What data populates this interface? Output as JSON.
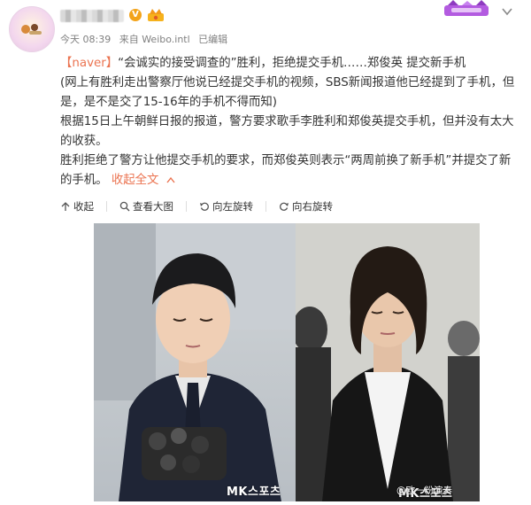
{
  "post": {
    "meta": {
      "time": "今天 08:39",
      "source": "来自 Weibo.intl",
      "edited": "已编辑"
    },
    "content": {
      "line1_tag": "【naver】",
      "line1_text": "“会诚实的接受调查的”胜利，拒绝提交手机……郑俊英 提交新手机",
      "line2": "(网上有胜利走出警察厅他说已经提交手机的视频，SBS新闻报道他已经提到了手机，但是，是不是交了15-16年的手机不得而知)",
      "line3": "根据15日上午朝鲜日报的报道，警方要求歌手李胜利和郑俊英提交手机，但并没有太大的收获。",
      "line4": "胜利拒绝了警方让他提交手机的要求，而郑俊英则表示“两周前换了新手机”并提交了新的手机。",
      "collapse_label": "收起全文"
    },
    "actions": {
      "collapse": "收起",
      "view_large": "查看大图",
      "rotate_left": "向左旋转",
      "rotate_right": "向右旋转"
    },
    "photos": {
      "left_watermark": "MK스포츠",
      "right_watermark": "MK스포츠",
      "weibo_watermark": "@欧一粉演奏"
    },
    "colors": {
      "link": "#eb7350",
      "text": "#333333",
      "meta": "#808080",
      "verified_badge": "#f3a31a"
    },
    "icons": {
      "verified": "v-badge-icon",
      "rank": "crown-icon",
      "collapse": "arrow-up-icon",
      "view_large": "magnifier-icon",
      "rotate_left": "rotate-left-icon",
      "rotate_right": "rotate-right-icon"
    }
  }
}
